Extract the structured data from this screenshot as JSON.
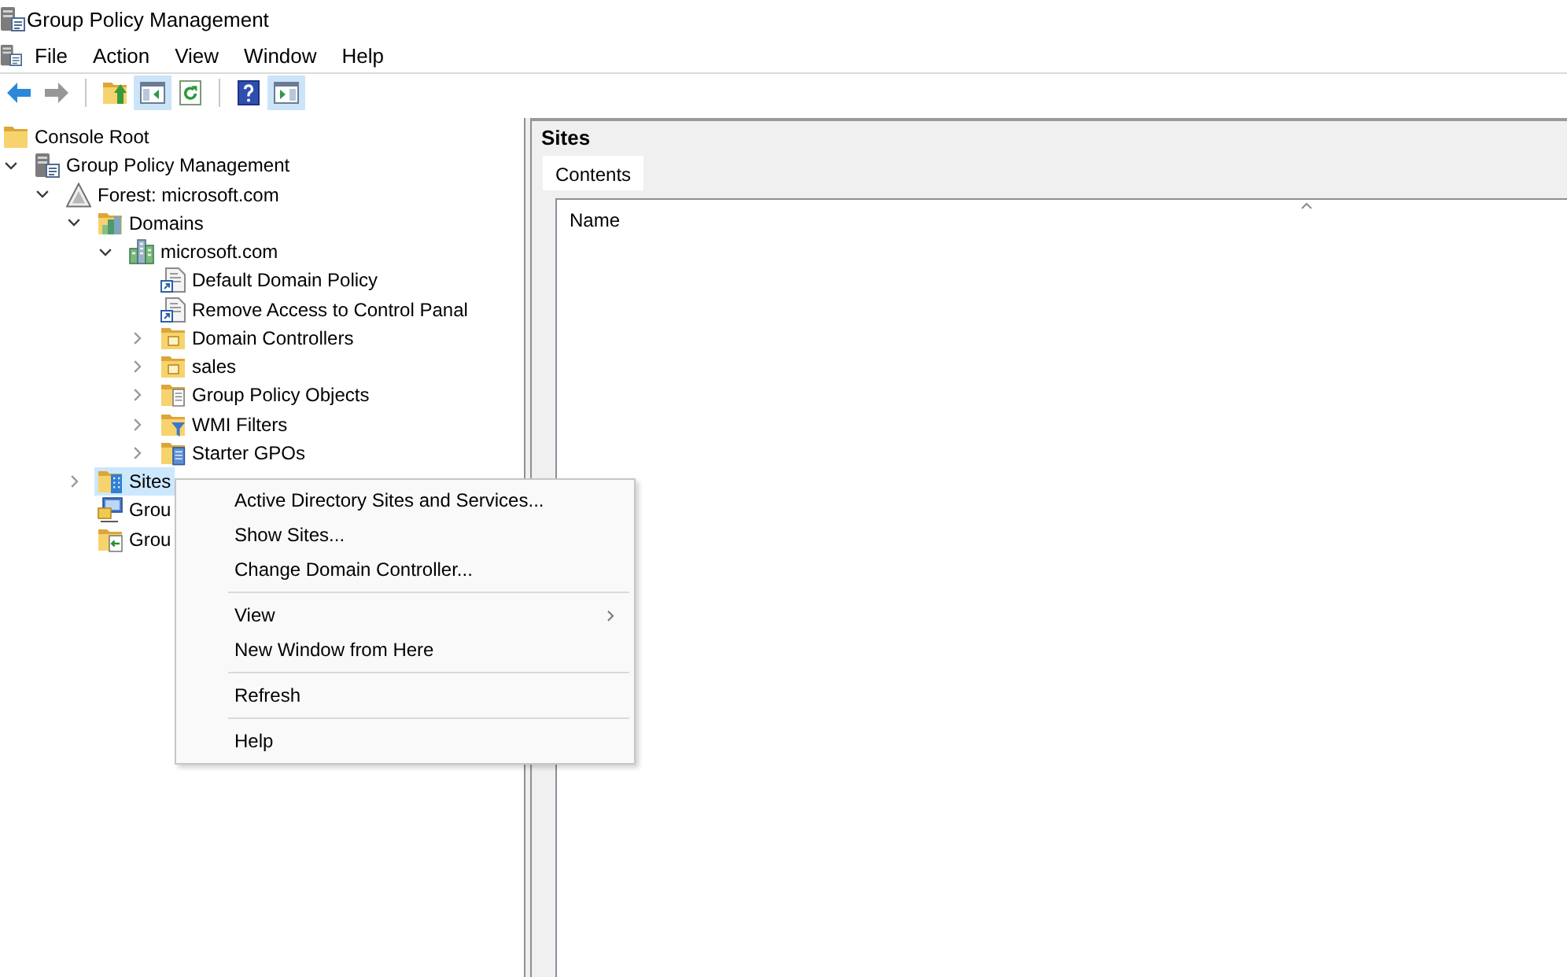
{
  "window": {
    "title": "Group Policy Management"
  },
  "menu_bar": {
    "items": [
      "File",
      "Action",
      "View",
      "Window",
      "Help"
    ]
  },
  "toolbar": [
    {
      "kind": "back",
      "disabled": false,
      "pressed": false
    },
    {
      "kind": "forward",
      "disabled": true,
      "pressed": false
    },
    {
      "kind": "separator"
    },
    {
      "kind": "up",
      "disabled": false,
      "pressed": false
    },
    {
      "kind": "console_tree",
      "disabled": false,
      "pressed": true
    },
    {
      "kind": "refresh",
      "disabled": false,
      "pressed": false
    },
    {
      "kind": "separator"
    },
    {
      "kind": "help",
      "disabled": false,
      "pressed": false
    },
    {
      "kind": "action_pane",
      "disabled": false,
      "pressed": true
    }
  ],
  "tree": [
    {
      "label": "Console Root",
      "kind": "folder",
      "selected": false,
      "children": [
        {
          "label": "Group Policy Management",
          "kind": "gpm",
          "expanded": true,
          "selected": false,
          "children": [
            {
              "label": "Forest: microsoft.com",
              "kind": "forest",
              "expanded": true,
              "selected": false,
              "children": [
                {
                  "label": "Domains",
                  "kind": "domains",
                  "expanded": true,
                  "selected": false,
                  "children": [
                    {
                      "label": "microsoft.com",
                      "kind": "domain",
                      "expanded": true,
                      "selected": false,
                      "children": [
                        {
                          "label": "Default Domain Policy",
                          "kind": "gpo_link",
                          "selected": false
                        },
                        {
                          "label": "Remove Access to Control Panal",
                          "kind": "gpo_link",
                          "selected": false
                        },
                        {
                          "label": "Domain Controllers",
                          "kind": "ou",
                          "expanded": false,
                          "selected": false
                        },
                        {
                          "label": "sales",
                          "kind": "ou",
                          "expanded": false,
                          "selected": false
                        },
                        {
                          "label": "Group Policy Objects",
                          "kind": "gpo_container",
                          "expanded": false,
                          "selected": false
                        },
                        {
                          "label": "WMI Filters",
                          "kind": "wmi_container",
                          "expanded": false,
                          "selected": false
                        },
                        {
                          "label": "Starter GPOs",
                          "kind": "starter_container",
                          "expanded": false,
                          "selected": false
                        }
                      ]
                    }
                  ]
                },
                {
                  "label": "Sites",
                  "kind": "sites",
                  "expanded": false,
                  "selected": true
                },
                {
                  "label": "Grou",
                  "kind": "modeling",
                  "selected": false
                },
                {
                  "label": "Grou",
                  "kind": "results",
                  "selected": false
                }
              ]
            }
          ]
        }
      ]
    }
  ],
  "context_menu": {
    "groups": [
      [
        {
          "label": "Active Directory Sites and Services...",
          "submenu": false
        },
        {
          "label": "Show Sites...",
          "submenu": false
        },
        {
          "label": "Change Domain Controller...",
          "submenu": false
        }
      ],
      [
        {
          "label": "View",
          "submenu": true
        },
        {
          "label": "New Window from Here",
          "submenu": false
        }
      ],
      [
        {
          "label": "Refresh",
          "submenu": false
        }
      ],
      [
        {
          "label": "Help",
          "submenu": false
        }
      ]
    ]
  },
  "details_pane": {
    "title": "Sites",
    "tabs": [
      {
        "label": "Contents",
        "selected": true
      }
    ],
    "list": {
      "columns": [
        {
          "label": "Name",
          "sorted": true
        }
      ]
    }
  }
}
